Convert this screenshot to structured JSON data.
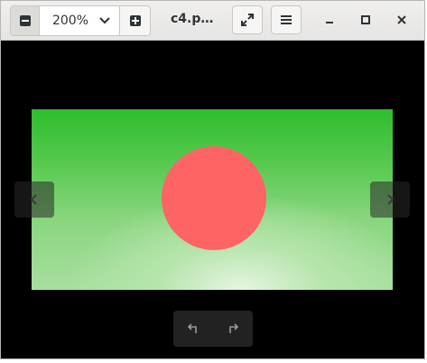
{
  "window": {
    "title": "c4.p…"
  },
  "toolbar": {
    "zoom_out_icon": "zoom-out-icon",
    "zoom_level": "200%",
    "zoom_dropdown_icon": "chevron-down-icon",
    "zoom_in_icon": "zoom-in-icon",
    "fullscreen_icon": "fullscreen-icon",
    "menu_icon": "hamburger-menu-icon"
  },
  "window_controls": {
    "minimize_icon": "minimize-icon",
    "maximize_icon": "maximize-icon",
    "close_icon": "close-icon"
  },
  "viewer": {
    "image": {
      "background_top": "#2ebd2e",
      "background_bottom": "#e6f5e2",
      "circle_color": "#ff6464"
    },
    "prev_icon": "chevron-left-icon",
    "next_icon": "chevron-right-icon",
    "rotate_left_icon": "rotate-left-icon",
    "rotate_right_icon": "rotate-right-icon"
  },
  "colors": {
    "headerbar": "#e9e8e6",
    "canvas": "#000000",
    "icon": "#2e3436"
  }
}
